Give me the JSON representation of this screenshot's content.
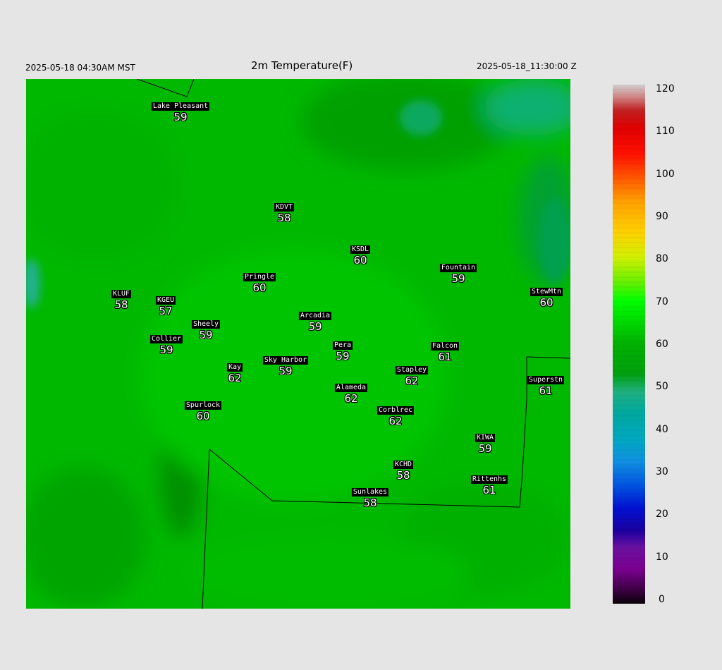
{
  "header": {
    "local_time": "2025-05-18 04:30AM MST",
    "title": "2m Temperature(F)",
    "utc_time": "2025-05-18_11:30:00 Z"
  },
  "stations": [
    {
      "name": "Lake Pleasant",
      "value": 59
    },
    {
      "name": "KDVT",
      "value": 58
    },
    {
      "name": "KSDL",
      "value": 60
    },
    {
      "name": "Fountain",
      "value": 59
    },
    {
      "name": "StewMtn",
      "value": 60
    },
    {
      "name": "Pringle",
      "value": 60
    },
    {
      "name": "KLUF",
      "value": 58
    },
    {
      "name": "KGEU",
      "value": 57
    },
    {
      "name": "Arcadia",
      "value": 59
    },
    {
      "name": "Sheely",
      "value": 59
    },
    {
      "name": "Collier",
      "value": 59
    },
    {
      "name": "Pera",
      "value": 59
    },
    {
      "name": "Falcon",
      "value": 61
    },
    {
      "name": "Kay",
      "value": 62
    },
    {
      "name": "Sky Harbor",
      "value": 59
    },
    {
      "name": "Stapley",
      "value": 62
    },
    {
      "name": "Superstn",
      "value": 61
    },
    {
      "name": "Alameda",
      "value": 62
    },
    {
      "name": "Spurlock",
      "value": 60
    },
    {
      "name": "Corblrec",
      "value": 62
    },
    {
      "name": "KIWA",
      "value": 59
    },
    {
      "name": "KCHD",
      "value": 58
    },
    {
      "name": "Rittenhs",
      "value": 61
    },
    {
      "name": "Sunlakes",
      "value": 58
    }
  ],
  "colorbar": {
    "ticks": [
      "120",
      "110",
      "100",
      "90",
      "80",
      "70",
      "60",
      "50",
      "40",
      "30",
      "20",
      "10",
      "0"
    ],
    "stops": [
      {
        "v": 0,
        "c": "#0a000a"
      },
      {
        "v": 3,
        "c": "#3a0040"
      },
      {
        "v": 8,
        "c": "#7a0090"
      },
      {
        "v": 13,
        "c": "#6a10a0"
      },
      {
        "v": 17,
        "c": "#1a00a0"
      },
      {
        "v": 22,
        "c": "#0010d0"
      },
      {
        "v": 27,
        "c": "#0050e0"
      },
      {
        "v": 33,
        "c": "#1090e0"
      },
      {
        "v": 38,
        "c": "#00a8c0"
      },
      {
        "v": 44,
        "c": "#00a8a0"
      },
      {
        "v": 49,
        "c": "#20b080"
      },
      {
        "v": 53,
        "c": "#00a010"
      },
      {
        "v": 60,
        "c": "#00b000"
      },
      {
        "v": 66,
        "c": "#00e000"
      },
      {
        "v": 70,
        "c": "#00ff00"
      },
      {
        "v": 74,
        "c": "#60f000"
      },
      {
        "v": 80,
        "c": "#d0f000"
      },
      {
        "v": 86,
        "c": "#ffd000"
      },
      {
        "v": 93,
        "c": "#ffa000"
      },
      {
        "v": 99,
        "c": "#ff5000"
      },
      {
        "v": 104,
        "c": "#ff1000"
      },
      {
        "v": 110,
        "c": "#e00000"
      },
      {
        "v": 114,
        "c": "#c02020"
      },
      {
        "v": 117,
        "c": "#d08080"
      },
      {
        "v": 120,
        "c": "#d0d0d0"
      }
    ]
  }
}
